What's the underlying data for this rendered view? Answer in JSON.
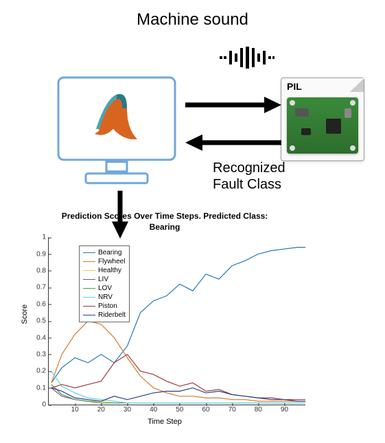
{
  "headline": "Machine sound",
  "pil_label": "PIL",
  "fault_label_line1": "Recognized",
  "fault_label_line2": "Fault Class",
  "chart_data": {
    "type": "line",
    "title_line1": "Prediction Scores Over Time Steps. Predicted Class:",
    "title_line2": "Bearing",
    "xlabel": "Time Step",
    "ylabel": "Score",
    "xlim": [
      0,
      98
    ],
    "ylim": [
      0,
      1
    ],
    "xticks": [
      10,
      20,
      30,
      40,
      50,
      60,
      70,
      80,
      90
    ],
    "yticks": [
      0,
      0.1,
      0.2,
      0.3,
      0.4,
      0.5,
      0.6,
      0.7,
      0.8,
      0.9,
      1
    ],
    "colors": {
      "Bearing": "#1f77b4",
      "Flywheel": "#d67b2a",
      "Healthy": "#e8d13a",
      "LIV": "#7a4fa0",
      "LOV": "#4aa04a",
      "NRV": "#5fcfe8",
      "Piston": "#a03a3a",
      "Riderbelt": "#2a3f8f"
    },
    "legend": [
      "Bearing",
      "Flywheel",
      "Healthy",
      "LIV",
      "LOV",
      "NRV",
      "Piston",
      "Riderbelt"
    ],
    "x": [
      1,
      5,
      10,
      15,
      20,
      25,
      30,
      35,
      40,
      45,
      50,
      55,
      60,
      65,
      70,
      75,
      80,
      85,
      90,
      95,
      98
    ],
    "series": [
      {
        "name": "Bearing",
        "values": [
          0.13,
          0.22,
          0.28,
          0.25,
          0.3,
          0.25,
          0.35,
          0.55,
          0.62,
          0.65,
          0.72,
          0.68,
          0.78,
          0.75,
          0.83,
          0.86,
          0.9,
          0.92,
          0.93,
          0.94,
          0.94
        ]
      },
      {
        "name": "Flywheel",
        "values": [
          0.13,
          0.3,
          0.42,
          0.5,
          0.48,
          0.4,
          0.28,
          0.17,
          0.1,
          0.07,
          0.05,
          0.05,
          0.04,
          0.04,
          0.03,
          0.03,
          0.02,
          0.02,
          0.02,
          0.02,
          0.02
        ]
      },
      {
        "name": "Healthy",
        "values": [
          0.12,
          0.06,
          0.03,
          0.02,
          0.02,
          0.01,
          0.01,
          0.01,
          0.01,
          0.01,
          0.01,
          0.01,
          0.01,
          0.01,
          0.01,
          0.01,
          0.01,
          0.01,
          0.01,
          0.01,
          0.01
        ]
      },
      {
        "name": "LIV",
        "values": [
          0.1,
          0.05,
          0.03,
          0.02,
          0.01,
          0.01,
          0.01,
          0.01,
          0.01,
          0.01,
          0.01,
          0.01,
          0.01,
          0.01,
          0.01,
          0.01,
          0.01,
          0.01,
          0.01,
          0.01,
          0.01
        ]
      },
      {
        "name": "LOV",
        "values": [
          0.12,
          0.06,
          0.03,
          0.02,
          0.01,
          0.01,
          0.01,
          0.01,
          0.01,
          0.01,
          0.01,
          0.01,
          0.01,
          0.01,
          0.01,
          0.01,
          0.01,
          0.01,
          0.01,
          0.01,
          0.01
        ]
      },
      {
        "name": "NRV",
        "values": [
          0.2,
          0.11,
          0.07,
          0.04,
          0.03,
          0.02,
          0.01,
          0.01,
          0.01,
          0.01,
          0.01,
          0.01,
          0.01,
          0.01,
          0.01,
          0.01,
          0.01,
          0.01,
          0.01,
          0.01,
          0.01
        ]
      },
      {
        "name": "Piston",
        "values": [
          0.1,
          0.12,
          0.1,
          0.12,
          0.14,
          0.25,
          0.3,
          0.2,
          0.18,
          0.14,
          0.11,
          0.13,
          0.08,
          0.09,
          0.06,
          0.05,
          0.04,
          0.04,
          0.03,
          0.03,
          0.03
        ]
      },
      {
        "name": "Riderbelt",
        "values": [
          0.1,
          0.08,
          0.04,
          0.03,
          0.02,
          0.05,
          0.03,
          0.05,
          0.07,
          0.08,
          0.08,
          0.1,
          0.07,
          0.08,
          0.06,
          0.05,
          0.04,
          0.03,
          0.03,
          0.02,
          0.02
        ]
      }
    ]
  }
}
